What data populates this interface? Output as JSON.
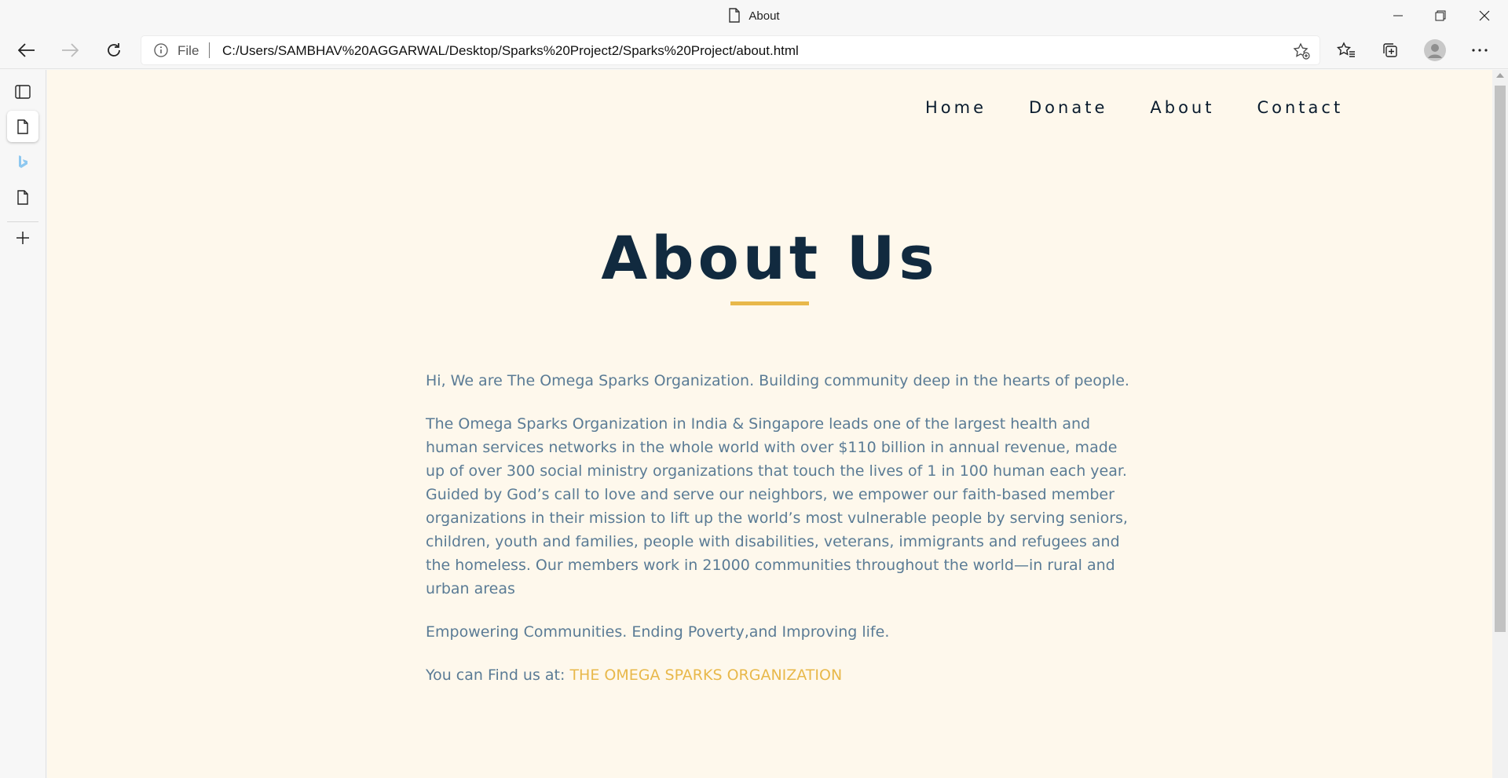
{
  "browser": {
    "window_title": "About",
    "address_prefix": "File",
    "url": "C:/Users/SAMBHAV%20AGGARWAL/Desktop/Sparks%20Project2/Sparks%20Project/about.html"
  },
  "page": {
    "nav": [
      "Home",
      "Donate",
      "About",
      "Contact"
    ],
    "heading": "About Us",
    "accent_color": "#e8b84a",
    "paragraphs": [
      "Hi, We are The Omega Sparks Organization. Building community deep in the hearts of people.",
      "The Omega Sparks Organization in India & Singapore leads one of the largest health and human services networks in the whole world with over $110 billion in annual revenue, made up of over 300 social ministry organizations that touch the lives of 1 in 100 human each year. Guided by God’s call to love and serve our neighbors, we empower our faith-based member organizations in their mission to lift up the world’s most vulnerable people by serving seniors, children, youth and families, people with disabilities, veterans, immigrants and refugees and the homeless. Our members work in 21000 communities throughout the world—in rural and urban areas",
      "Empowering Communities. Ending Poverty,and Improving life."
    ],
    "find_us_label": "You can Find us at:",
    "find_us_link": "THE OMEGA SPARKS ORGANIZATION"
  }
}
